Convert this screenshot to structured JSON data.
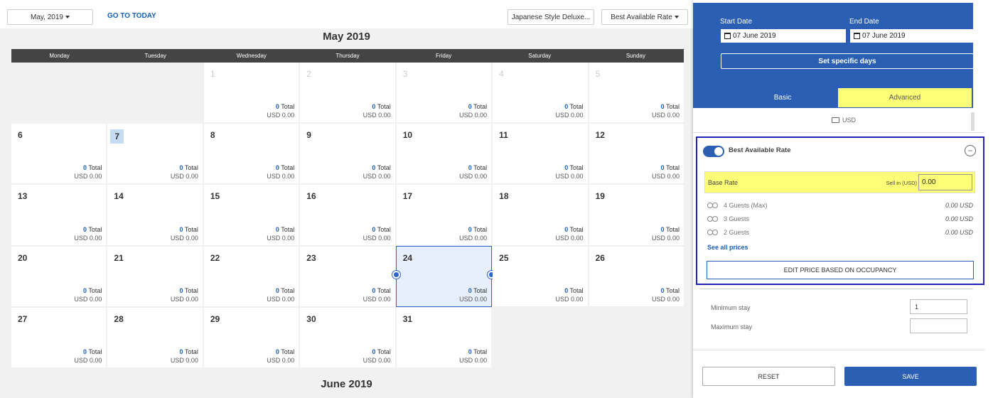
{
  "toolbar": {
    "month_select": "May, 2019",
    "goto_today": "GO TO TODAY",
    "room_select": "Japanese Style Deluxe...",
    "rate_select": "Best Available Rate"
  },
  "calendar": {
    "title": "May 2019",
    "next_title": "June 2019",
    "weekdays": [
      "Monday",
      "Tuesday",
      "Wednesday",
      "Thursday",
      "Friday",
      "Saturday",
      "Sunday"
    ],
    "total_suffix": "Total",
    "days": [
      {
        "d": "",
        "empty": true
      },
      {
        "d": "",
        "empty": true
      },
      {
        "d": "1",
        "dim": true,
        "total": "0",
        "price": "USD 0.00"
      },
      {
        "d": "2",
        "dim": true,
        "total": "0",
        "price": "USD 0.00"
      },
      {
        "d": "3",
        "dim": true,
        "total": "0",
        "price": "USD 0.00"
      },
      {
        "d": "4",
        "dim": true,
        "total": "0",
        "price": "USD 0.00"
      },
      {
        "d": "5",
        "dim": true,
        "total": "0",
        "price": "USD 0.00"
      },
      {
        "d": "6",
        "total": "0",
        "price": "USD 0.00"
      },
      {
        "d": "7",
        "today": true,
        "total": "0",
        "price": "USD 0.00"
      },
      {
        "d": "8",
        "total": "0",
        "price": "USD 0.00"
      },
      {
        "d": "9",
        "total": "0",
        "price": "USD 0.00"
      },
      {
        "d": "10",
        "total": "0",
        "price": "USD 0.00"
      },
      {
        "d": "11",
        "total": "0",
        "price": "USD 0.00"
      },
      {
        "d": "12",
        "total": "0",
        "price": "USD 0.00"
      },
      {
        "d": "13",
        "total": "0",
        "price": "USD 0.00"
      },
      {
        "d": "14",
        "total": "0",
        "price": "USD 0.00"
      },
      {
        "d": "15",
        "total": "0",
        "price": "USD 0.00"
      },
      {
        "d": "16",
        "total": "0",
        "price": "USD 0.00"
      },
      {
        "d": "17",
        "total": "0",
        "price": "USD 0.00"
      },
      {
        "d": "18",
        "total": "0",
        "price": "USD 0.00"
      },
      {
        "d": "19",
        "total": "0",
        "price": "USD 0.00"
      },
      {
        "d": "20",
        "total": "0",
        "price": "USD 0.00"
      },
      {
        "d": "21",
        "total": "0",
        "price": "USD 0.00"
      },
      {
        "d": "22",
        "total": "0",
        "price": "USD 0.00"
      },
      {
        "d": "23",
        "total": "0",
        "price": "USD 0.00"
      },
      {
        "d": "24",
        "selected": true,
        "total": "0",
        "price": "USD 0.00"
      },
      {
        "d": "25",
        "total": "0",
        "price": "USD 0.00"
      },
      {
        "d": "26",
        "total": "0",
        "price": "USD 0.00"
      },
      {
        "d": "27",
        "total": "0",
        "price": "USD 0.00"
      },
      {
        "d": "28",
        "total": "0",
        "price": "USD 0.00"
      },
      {
        "d": "29",
        "total": "0",
        "price": "USD 0.00"
      },
      {
        "d": "30",
        "total": "0",
        "price": "USD 0.00"
      },
      {
        "d": "31",
        "total": "0",
        "price": "USD 0.00"
      },
      {
        "d": "",
        "empty": true
      },
      {
        "d": "",
        "empty": true
      }
    ]
  },
  "panel": {
    "start_label": "Start Date",
    "start_value": "07 June 2019",
    "end_label": "End Date",
    "end_value": "07 June 2019",
    "specific_days": "Set specific days",
    "tab_basic": "Basic",
    "tab_advanced": "Advanced",
    "currency": "USD",
    "rate_name": "Best Available Rate",
    "base_rate": "Base Rate",
    "sell_label": "Sell in (USD)",
    "sell_value": "0.00",
    "guests": [
      {
        "label": "4 Guests (Max)",
        "price": "0.00 USD"
      },
      {
        "label": "3 Guests",
        "price": "0.00 USD"
      },
      {
        "label": "2 Guests",
        "price": "0.00 USD"
      }
    ],
    "see_all": "See all prices",
    "edit_occupancy": "EDIT PRICE BASED ON OCCUPANCY",
    "min_stay_label": "Minimum stay",
    "min_stay_value": "1",
    "max_stay_label": "Maximum stay",
    "max_stay_value": "",
    "reset": "RESET",
    "save": "SAVE"
  },
  "colors": {
    "primary": "#2b5fb4",
    "highlight": "#ffff77",
    "header_dark": "#444444",
    "focus_border": "#1f24b4"
  }
}
